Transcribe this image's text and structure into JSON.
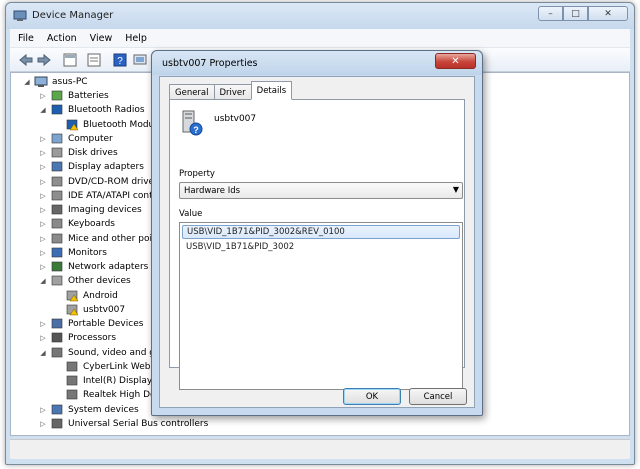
{
  "main_window": {
    "title": "Device Manager",
    "controls": {
      "minimize": "–",
      "maximize": "□",
      "close": "✕"
    }
  },
  "menu": [
    "File",
    "Action",
    "View",
    "Help"
  ],
  "tree": {
    "root": "asus-PC",
    "items": [
      {
        "label": "Batteries",
        "level": 1,
        "expander": "▷",
        "icon": "battery-icon"
      },
      {
        "label": "Bluetooth Radios",
        "level": 1,
        "expander": "◢",
        "icon": "bluetooth-icon"
      },
      {
        "label": "Bluetooth Module",
        "level": 2,
        "expander": "",
        "icon": "bluetooth-warning-icon"
      },
      {
        "label": "Computer",
        "level": 1,
        "expander": "▷",
        "icon": "computer-icon"
      },
      {
        "label": "Disk drives",
        "level": 1,
        "expander": "▷",
        "icon": "disk-icon"
      },
      {
        "label": "Display adapters",
        "level": 1,
        "expander": "▷",
        "icon": "display-icon"
      },
      {
        "label": "DVD/CD-ROM drives",
        "level": 1,
        "expander": "▷",
        "icon": "dvd-icon"
      },
      {
        "label": "IDE ATA/ATAPI contro",
        "level": 1,
        "expander": "▷",
        "icon": "ide-icon"
      },
      {
        "label": "Imaging devices",
        "level": 1,
        "expander": "▷",
        "icon": "camera-icon"
      },
      {
        "label": "Keyboards",
        "level": 1,
        "expander": "▷",
        "icon": "keyboard-icon"
      },
      {
        "label": "Mice and other pointin",
        "level": 1,
        "expander": "▷",
        "icon": "mouse-icon"
      },
      {
        "label": "Monitors",
        "level": 1,
        "expander": "▷",
        "icon": "monitor-icon"
      },
      {
        "label": "Network adapters",
        "level": 1,
        "expander": "▷",
        "icon": "network-icon"
      },
      {
        "label": "Other devices",
        "level": 1,
        "expander": "◢",
        "icon": "other-device-icon"
      },
      {
        "label": "Android",
        "level": 2,
        "expander": "",
        "icon": "warning-device-icon"
      },
      {
        "label": "usbtv007",
        "level": 2,
        "expander": "",
        "icon": "warning-device-icon"
      },
      {
        "label": "Portable Devices",
        "level": 1,
        "expander": "▷",
        "icon": "portable-icon"
      },
      {
        "label": "Processors",
        "level": 1,
        "expander": "▷",
        "icon": "processor-icon"
      },
      {
        "label": "Sound, video and gam",
        "level": 1,
        "expander": "◢",
        "icon": "speaker-icon"
      },
      {
        "label": "CyberLink WebCar",
        "level": 2,
        "expander": "",
        "icon": "speaker-icon"
      },
      {
        "label": "Intel(R) Display Au",
        "level": 2,
        "expander": "",
        "icon": "speaker-icon"
      },
      {
        "label": "Realtek High Defin",
        "level": 2,
        "expander": "",
        "icon": "speaker-icon"
      },
      {
        "label": "System devices",
        "level": 1,
        "expander": "▷",
        "icon": "system-icon"
      },
      {
        "label": "Universal Serial Bus controllers",
        "level": 1,
        "expander": "▷",
        "icon": "usb-icon"
      }
    ]
  },
  "dialog": {
    "title": "usbtv007 Properties",
    "close": "✕",
    "tabs": [
      "General",
      "Driver",
      "Details"
    ],
    "active_tab": "Details",
    "device_name": "usbtv007",
    "property_label": "Property",
    "property_value": "Hardware Ids",
    "value_label": "Value",
    "values": [
      "USB\\VID_1B71&PID_3002&REV_0100",
      "USB\\VID_1B71&PID_3002"
    ],
    "ok": "OK",
    "cancel": "Cancel"
  },
  "colors": {
    "accent": "#3c7fb1",
    "close_red": "#c8453a",
    "warning": "#f2c200"
  }
}
